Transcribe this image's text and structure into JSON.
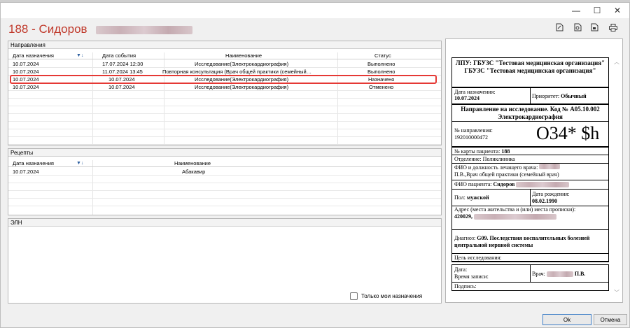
{
  "window": {
    "title": "188 - Сидоров",
    "min_glyph": "—",
    "max_glyph": "☐",
    "close_glyph": "✕"
  },
  "directions": {
    "title": "Направления",
    "columns": [
      "Дата назначения",
      "Дата события",
      "Наименование",
      "Статус"
    ],
    "rows": [
      [
        "10.07.2024",
        "17.07.2024 12:30",
        "Исследование(Электрокардиография)",
        "Выполнено"
      ],
      [
        "10.07.2024",
        "11.07.2024 13:45",
        "Повторная консультация (Врач общей практики (семейный…",
        "Выполнено"
      ],
      [
        "10.07.2024",
        "10.07.2024",
        "Исследование(Электрокардиография)",
        "Назначено"
      ],
      [
        "10.07.2024",
        "10.07.2024",
        "Исследование(Электрокардиография)",
        "Отменено"
      ]
    ],
    "selected_index": 2
  },
  "recipes": {
    "title": "Рецепты",
    "columns": [
      "Дата назначения",
      "Наименование"
    ],
    "rows": [
      [
        "10.07.2024",
        "Абакавир"
      ]
    ]
  },
  "eln": {
    "title": "ЭЛН"
  },
  "only_mine": {
    "label": "Только мои назначения",
    "checked": false
  },
  "toolbar_icons": [
    "edit-document-icon",
    "export-icon",
    "share-icon",
    "print-icon"
  ],
  "doc": {
    "header": "ЛПУ: ГБУЗС \"Тестовая медицинская организация\" ГБУЗС \"Тестовая медицинская организация\"",
    "date_label": "Дата назначения:",
    "date_value": "10.07.2024",
    "priority_label": "Приоритет:",
    "priority_value": "Обычный",
    "direction_title": "Направление на исследование. Код № A05.10.002 Электрокардиография",
    "num_label": "№ направления:",
    "num_value": "192010000472",
    "barcode_text": "O34* $h",
    "card_label": "№ карты пациента:",
    "card_value": "188",
    "dept_label": "Отделение:",
    "dept_value": "Поликлиника",
    "doctor_label": "ФИО и должность лечащего врача:",
    "doctor_value": "П.В.,Врач общей практики (семейный врач)",
    "patient_label": "ФИО пациента:",
    "patient_value": "Сидоров",
    "sex_label": "Пол:",
    "sex_value": "мужской",
    "birth_label": "Дата рождения:",
    "birth_value": "08.02.1990",
    "address_label": "Адрес (места жительства и (или) места прописки):",
    "address_value": "420029,",
    "diag_label": "Диагноз:",
    "diag_value": "G09. Последствия воспалительных болезней центральной нервной системы",
    "goal_label": "Цель исследования:",
    "record_date_label": "Дата:",
    "record_time_label": "Время записи:",
    "doctor2_label": "Врач:",
    "doctor2_value": "П.В.",
    "sign_label": "Подпись:"
  },
  "buttons": {
    "ok": "Ok",
    "cancel": "Отмена"
  }
}
